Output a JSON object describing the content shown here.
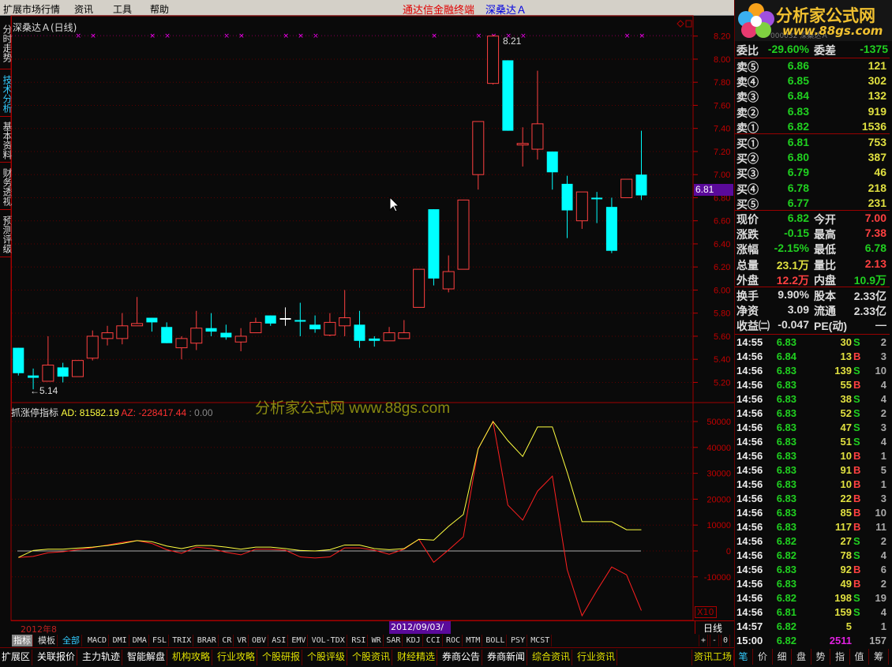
{
  "menu": {
    "items": [
      "扩展市场行情",
      "资讯",
      "工具",
      "帮助"
    ],
    "app_title": "通达信金融终端",
    "stock_title": "深桑达Ａ"
  },
  "left_tabs": [
    "分时走势",
    "技术分析",
    "基本资料",
    "财务透视",
    "预测评级"
  ],
  "chart": {
    "title": "深桑达Ａ(日线)",
    "high_label": "8.21",
    "low_label": "←5.14",
    "current_price_label": "6.81",
    "watermark": "分析家公式网 www.88gs.com",
    "colors": {
      "up": "#ff4040",
      "down": "#00ffff",
      "flat": "#ffffff",
      "marker": "#ff00ff",
      "axis": "#c00000"
    }
  },
  "chart_data": [
    {
      "type": "candlestick",
      "title": "深桑达Ａ(日线)",
      "ylim": [
        5.1,
        8.25
      ],
      "yticks": [
        "8.20",
        "8.00",
        "7.80",
        "7.60",
        "7.40",
        "7.20",
        "7.00",
        "6.80",
        "6.60",
        "6.40",
        "6.20",
        "6.00",
        "5.80",
        "5.60",
        "5.40",
        "5.20"
      ],
      "ohlc": [
        [
          5.5,
          5.5,
          5.26,
          5.28
        ],
        [
          5.26,
          5.32,
          5.14,
          5.24
        ],
        [
          5.21,
          5.6,
          5.21,
          5.35
        ],
        [
          5.33,
          5.37,
          5.2,
          5.25
        ],
        [
          5.25,
          5.39,
          5.25,
          5.39
        ],
        [
          5.41,
          5.65,
          5.39,
          5.6
        ],
        [
          5.58,
          5.69,
          5.52,
          5.63
        ],
        [
          5.58,
          5.8,
          5.53,
          5.69
        ],
        [
          5.69,
          5.94,
          5.69,
          5.71
        ],
        [
          5.76,
          5.76,
          5.64,
          5.72
        ],
        [
          5.68,
          5.72,
          5.54,
          5.54
        ],
        [
          5.5,
          5.6,
          5.4,
          5.58
        ],
        [
          5.54,
          5.82,
          5.48,
          5.67
        ],
        [
          5.67,
          5.8,
          5.6,
          5.64
        ],
        [
          5.63,
          5.7,
          5.57,
          5.59
        ],
        [
          5.55,
          5.67,
          5.47,
          5.6
        ],
        [
          5.63,
          5.76,
          5.63,
          5.72
        ],
        [
          5.78,
          5.78,
          5.69,
          5.71
        ],
        [
          5.75,
          5.85,
          5.69,
          5.75
        ],
        [
          5.74,
          5.89,
          5.6,
          5.73
        ],
        [
          5.7,
          5.78,
          5.63,
          5.66
        ],
        [
          5.61,
          5.8,
          5.6,
          5.72
        ],
        [
          5.69,
          6.0,
          5.6,
          5.76
        ],
        [
          5.7,
          5.82,
          5.5,
          5.56
        ],
        [
          5.58,
          5.6,
          5.51,
          5.56
        ],
        [
          5.56,
          5.68,
          5.56,
          5.63
        ],
        [
          5.58,
          5.74,
          5.58,
          5.63
        ],
        [
          5.85,
          6.18,
          5.85,
          6.18
        ],
        [
          6.7,
          6.7,
          6.04,
          6.1
        ],
        [
          6.01,
          6.3,
          5.98,
          6.16
        ],
        [
          6.18,
          6.78,
          6.18,
          6.78
        ],
        [
          7.0,
          7.46,
          6.87,
          7.46
        ],
        [
          7.79,
          8.21,
          7.78,
          8.2
        ],
        [
          7.99,
          7.99,
          7.38,
          7.38
        ],
        [
          7.26,
          7.41,
          7.07,
          7.27
        ],
        [
          7.22,
          7.9,
          7.13,
          7.44
        ],
        [
          7.2,
          7.2,
          6.87,
          7.02
        ],
        [
          6.92,
          6.99,
          6.45,
          6.69
        ],
        [
          6.6,
          6.85,
          6.53,
          6.85
        ],
        [
          6.8,
          6.85,
          6.58,
          6.79
        ],
        [
          6.72,
          6.8,
          6.32,
          6.34
        ],
        [
          6.8,
          6.96,
          6.8,
          6.96
        ],
        [
          7.0,
          7.38,
          6.78,
          6.82
        ]
      ],
      "signal_marker_indices": [
        4,
        5,
        9,
        10,
        14,
        15,
        18,
        19,
        20,
        28,
        31,
        32,
        33,
        34,
        41,
        42
      ]
    },
    {
      "type": "line",
      "title": "抓涨停指标",
      "ylim": [
        -20000,
        55000
      ],
      "yticks": [
        "50000",
        "40000",
        "30000",
        "20000",
        "10000",
        "0",
        "-10000"
      ],
      "scale_label": "X10",
      "series": [
        {
          "name": "AD",
          "color": "#ffff40",
          "values": [
            -2500,
            200,
            700,
            700,
            1100,
            1500,
            2100,
            2900,
            4000,
            3600,
            1900,
            900,
            2100,
            2100,
            1500,
            700,
            1500,
            1500,
            900,
            200,
            0,
            500,
            2300,
            2300,
            900,
            500,
            900,
            4500,
            4200,
            9500,
            14100,
            39500,
            50000,
            42600,
            36500,
            47900,
            47900,
            30400,
            11300,
            11300,
            11300,
            8200,
            8200
          ]
        },
        {
          "name": "AZ",
          "color": "#ff2020",
          "values": [
            -2500,
            -2100,
            -700,
            -300,
            500,
            1300,
            2300,
            3300,
            4000,
            2900,
            500,
            -900,
            1500,
            900,
            -500,
            -1500,
            700,
            700,
            300,
            -2300,
            -2700,
            -2300,
            1200,
            1200,
            300,
            -1300,
            700,
            4500,
            -4400,
            400,
            5500,
            39500,
            50000,
            17700,
            11900,
            23100,
            28900,
            -7200,
            -25000,
            -15300,
            -6200,
            -9200,
            -23000
          ]
        }
      ]
    }
  ],
  "indicator_header": {
    "name": "抓涨停指标",
    "ad": "AD: 81582.19",
    "az": "AZ: -228417.44",
    "extra": ": 0.00"
  },
  "datebar": {
    "left": "2012年8",
    "cursor_date": "2012/09/03/一",
    "period": "日线"
  },
  "indicator_tabs": {
    "left": [
      "指标",
      "模板",
      "全部"
    ],
    "items": [
      "MACD",
      "DMI",
      "DMA",
      "FSL",
      "TRIX",
      "BRAR",
      "CR",
      "VR",
      "OBV",
      "ASI",
      "EMV",
      "VOL-TDX",
      "RSI",
      "WR",
      "SAR",
      "KDJ",
      "CCI",
      "ROC",
      "MTM",
      "BOLL",
      "PSY",
      "MCST"
    ],
    "right": [
      "+",
      "-",
      "0"
    ]
  },
  "bottom_tabs": [
    {
      "label": "扩展区",
      "color": "#ffffff"
    },
    {
      "label": "关联报价",
      "color": "#ffffff"
    },
    {
      "label": "主力轨迹",
      "color": "#ffffff"
    },
    {
      "label": "智能解盘",
      "color": "#ffffff"
    },
    {
      "label": "机构攻略",
      "color": "#e0e000"
    },
    {
      "label": "行业攻略",
      "color": "#e0e000"
    },
    {
      "label": "个股研报",
      "color": "#e0e000"
    },
    {
      "label": "个股评级",
      "color": "#e0e000"
    },
    {
      "label": "个股资讯",
      "color": "#e0e000"
    },
    {
      "label": "财经精选",
      "color": "#e0e000"
    },
    {
      "label": "券商公告",
      "color": "#ffffff"
    },
    {
      "label": "券商新闻",
      "color": "#ffffff"
    },
    {
      "label": "综合资讯",
      "color": "#e0e000"
    },
    {
      "label": "行业资讯",
      "color": "#e0e000"
    }
  ],
  "right_bottom": {
    "info_label": "资讯工场",
    "tabs": [
      "笔",
      "价",
      "细",
      "盘",
      "势",
      "指",
      "值",
      "筹"
    ]
  },
  "logo": {
    "text": "分析家公式网",
    "url": "www.88gs.com",
    "sub": "000032 深桑达Ａ"
  },
  "quote": {
    "weibi": {
      "l1": "委比",
      "v1": "-29.60%",
      "l2": "委差",
      "v2": "-1375"
    },
    "sell": [
      {
        "label": "卖⑤",
        "price": "6.86",
        "vol": "121"
      },
      {
        "label": "卖④",
        "price": "6.85",
        "vol": "302"
      },
      {
        "label": "卖③",
        "price": "6.84",
        "vol": "132"
      },
      {
        "label": "卖②",
        "price": "6.83",
        "vol": "919"
      },
      {
        "label": "卖①",
        "price": "6.82",
        "vol": "1536"
      }
    ],
    "buy": [
      {
        "label": "买①",
        "price": "6.81",
        "vol": "753"
      },
      {
        "label": "买②",
        "price": "6.80",
        "vol": "387"
      },
      {
        "label": "买③",
        "price": "6.79",
        "vol": "46"
      },
      {
        "label": "买④",
        "price": "6.78",
        "vol": "218"
      },
      {
        "label": "买⑤",
        "price": "6.77",
        "vol": "231"
      }
    ],
    "stats": [
      {
        "l1": "现价",
        "v1": "6.82",
        "c1": "#20d020",
        "l2": "今开",
        "v2": "7.00",
        "c2": "#ff4040"
      },
      {
        "l1": "涨跌",
        "v1": "-0.15",
        "c1": "#20d020",
        "l2": "最高",
        "v2": "7.38",
        "c2": "#ff4040"
      },
      {
        "l1": "涨幅",
        "v1": "-2.15%",
        "c1": "#20d020",
        "l2": "最低",
        "v2": "6.78",
        "c2": "#20d020"
      },
      {
        "l1": "总量",
        "v1": "23.1万",
        "c1": "#e0e040",
        "l2": "量比",
        "v2": "2.13",
        "c2": "#ff4040"
      },
      {
        "l1": "外盘",
        "v1": "12.2万",
        "c1": "#ff4040",
        "l2": "内盘",
        "v2": "10.9万",
        "c2": "#20d020"
      }
    ],
    "fund": [
      {
        "l1": "换手",
        "v1": "9.90%",
        "l2": "股本",
        "v2": "2.33亿"
      },
      {
        "l1": "净资",
        "v1": "3.09",
        "l2": "流通",
        "v2": "2.33亿"
      },
      {
        "l1": "收益㈡",
        "v1": "-0.047",
        "l2": "PE(动)",
        "v2": "—"
      }
    ]
  },
  "ticks": [
    {
      "time": "14:55",
      "price": "6.83",
      "vol": "30",
      "bs": "S",
      "n": "2"
    },
    {
      "time": "14:56",
      "price": "6.84",
      "vol": "13",
      "bs": "B",
      "n": "3"
    },
    {
      "time": "14:56",
      "price": "6.83",
      "vol": "139",
      "bs": "S",
      "n": "10"
    },
    {
      "time": "14:56",
      "price": "6.83",
      "vol": "55",
      "bs": "B",
      "n": "4"
    },
    {
      "time": "14:56",
      "price": "6.83",
      "vol": "38",
      "bs": "S",
      "n": "4"
    },
    {
      "time": "14:56",
      "price": "6.83",
      "vol": "52",
      "bs": "S",
      "n": "2"
    },
    {
      "time": "14:56",
      "price": "6.83",
      "vol": "47",
      "bs": "S",
      "n": "3"
    },
    {
      "time": "14:56",
      "price": "6.83",
      "vol": "51",
      "bs": "S",
      "n": "4"
    },
    {
      "time": "14:56",
      "price": "6.83",
      "vol": "10",
      "bs": "B",
      "n": "1"
    },
    {
      "time": "14:56",
      "price": "6.83",
      "vol": "91",
      "bs": "B",
      "n": "5"
    },
    {
      "time": "14:56",
      "price": "6.83",
      "vol": "10",
      "bs": "B",
      "n": "1"
    },
    {
      "time": "14:56",
      "price": "6.83",
      "vol": "22",
      "bs": "B",
      "n": "3"
    },
    {
      "time": "14:56",
      "price": "6.83",
      "vol": "85",
      "bs": "B",
      "n": "10"
    },
    {
      "time": "14:56",
      "price": "6.83",
      "vol": "117",
      "bs": "B",
      "n": "11"
    },
    {
      "time": "14:56",
      "price": "6.82",
      "vol": "27",
      "bs": "S",
      "n": "2"
    },
    {
      "time": "14:56",
      "price": "6.82",
      "vol": "78",
      "bs": "S",
      "n": "4"
    },
    {
      "time": "14:56",
      "price": "6.83",
      "vol": "92",
      "bs": "B",
      "n": "6"
    },
    {
      "time": "14:56",
      "price": "6.83",
      "vol": "49",
      "bs": "B",
      "n": "2"
    },
    {
      "time": "14:56",
      "price": "6.82",
      "vol": "198",
      "bs": "S",
      "n": "19"
    },
    {
      "time": "14:56",
      "price": "6.81",
      "vol": "159",
      "bs": "S",
      "n": "4"
    },
    {
      "time": "14:57",
      "price": "6.82",
      "vol": "5",
      "bs": "",
      "n": "1"
    },
    {
      "time": "15:00",
      "price": "6.82",
      "vol": "2511",
      "bs": "",
      "n": "157",
      "vol_color": "#e020e0"
    }
  ]
}
